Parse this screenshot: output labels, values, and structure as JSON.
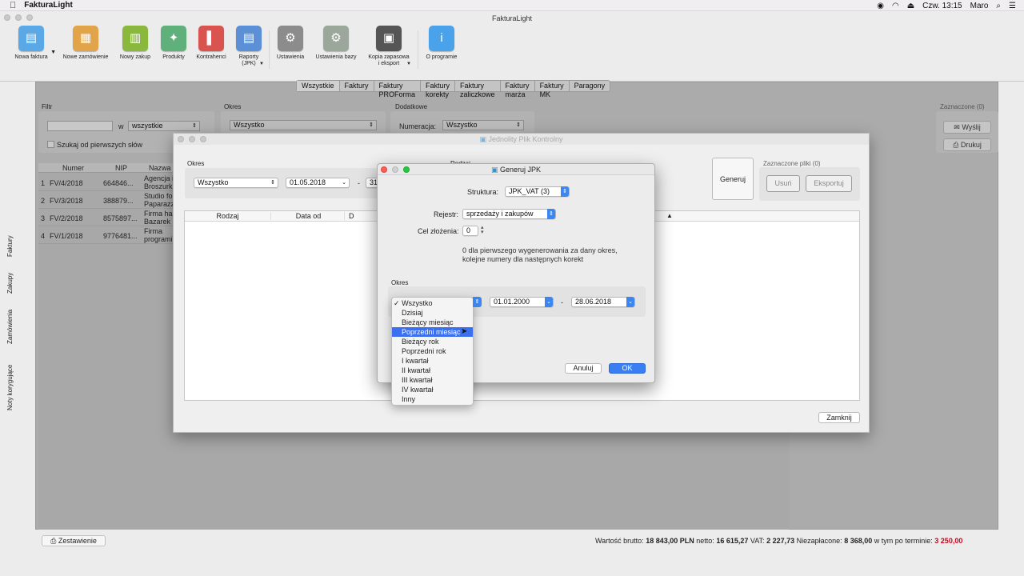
{
  "menubar": {
    "app": "FakturaLight",
    "clock": "Czw. 13:15",
    "user": "Maro"
  },
  "window": {
    "title": "FakturaLight"
  },
  "toolbar": {
    "items": [
      {
        "label": "Nowa faktura",
        "icon": "new-invoice-icon",
        "color": "#5aa8e6"
      },
      {
        "label": "Nowe zamówienie",
        "icon": "new-order-icon",
        "color": "#e2a44a"
      },
      {
        "label": "Nowy zakup",
        "icon": "basket-icon",
        "color": "#8ab83d"
      },
      {
        "label": "Produkty",
        "icon": "products-icon",
        "color": "#5fb07a"
      },
      {
        "label": "Kontrahenci",
        "icon": "contacts-icon",
        "color": "#d9534f"
      },
      {
        "label": "Raporty",
        "label2": "(JPK)",
        "icon": "reports-icon",
        "color": "#5b8fd6"
      },
      {
        "label": "Ustawienia",
        "icon": "settings-icon",
        "color": "#8c8c8c"
      },
      {
        "label": "Ustawienia bazy",
        "icon": "database-settings-icon",
        "color": "#9aa79a"
      },
      {
        "label": "Kopia zapasowa",
        "label2": "i eksport",
        "icon": "backup-icon",
        "color": "#555555"
      },
      {
        "label": "O programie",
        "icon": "info-icon",
        "color": "#4aa3ea"
      }
    ]
  },
  "tabs": [
    "Wszystkie",
    "Faktury",
    "Faktury PROForma",
    "Faktury korekty",
    "Faktury zaliczkowe",
    "Faktury marża",
    "Faktury MK",
    "Paragony"
  ],
  "filter": {
    "filtr_label": "Filtr",
    "w_label": "w",
    "w_value": "wszystkie",
    "search_words": "Szukaj od pierwszych słów",
    "okres_label": "Okres",
    "okres_value": "Wszystko",
    "dodatkowe_label": "Dodatkowe",
    "numeracja_label": "Numeracja:",
    "numeracja_value": "Wszystko",
    "zaznaczone_label": "Zaznaczone (0)",
    "wyslij": "Wyślij",
    "drukuj": "Drukuj"
  },
  "invoice_table": {
    "headers": [
      "Numer",
      "NIP",
      "Nazwa"
    ],
    "rows": [
      {
        "n": "1",
        "numer": "FV/4/2018",
        "nip": "664846...",
        "nazwa": "Agencja i",
        "nazwa2": "Broszurk"
      },
      {
        "n": "2",
        "numer": "FV/3/2018",
        "nip": "388879...",
        "nazwa": "Studio fo",
        "nazwa2": "Paparazz"
      },
      {
        "n": "3",
        "numer": "FV/2/2018",
        "nip": "8575897...",
        "nazwa": "Firma ha",
        "nazwa2": "Bazarek"
      },
      {
        "n": "4",
        "numer": "FV/1/2018",
        "nip": "9776481...",
        "nazwa": "Firma",
        "nazwa2": "programi"
      }
    ]
  },
  "side_tabs": [
    "Faktury",
    "Zakupy",
    "Zamówienia",
    "Noty korygujące"
  ],
  "jpk_window": {
    "title": "Jednolity Plik Kontrolny",
    "okres_label": "Okres",
    "okres_value": "Wszystko",
    "date_from": "01.05.2018",
    "dash": "-",
    "date_to": "31.",
    "rodzaj_label": "Rodzaj",
    "generuj": "Generuj",
    "zaznaczone_pliki": "Zaznaczone pliki (0)",
    "usun": "Usuń",
    "eksportuj": "Eksportuj",
    "table_headers": [
      "Rodzaj",
      "Data od",
      "D"
    ],
    "zamknij": "Zamknij"
  },
  "dialog": {
    "title": "Generuj JPK",
    "struktura_label": "Struktura:",
    "struktura_value": "JPK_VAT (3)",
    "rejestr_label": "Rejestr:",
    "rejestr_value": "sprzedaży i zakupów",
    "cel_label": "Cel złożenia:",
    "cel_value": "0",
    "hint": "0 dla pierwszego wygenerowania za dany okres,",
    "hint2": "kolejne numery dla następnych korekt",
    "okres_label": "Okres",
    "date_from": "01.01.2000",
    "dash": "-",
    "date_to": "28.06.2018",
    "anuluj": "Anuluj",
    "ok": "OK"
  },
  "period_menu": {
    "selected": "Wszystko",
    "highlighted": "Poprzedni miesiąc",
    "items": [
      "Dzisiaj",
      "Bieżący miesiąc",
      "Poprzedni miesiąc",
      "Bieżący rok",
      "Poprzedni rok",
      "I kwartał",
      "II kwartał",
      "III kwartał",
      "IV kwartał",
      "Inny"
    ]
  },
  "footer": {
    "zestawienie": "Zestawienie",
    "brutto_label": "Wartość brutto:",
    "brutto": "18 843,00 PLN",
    "netto_label": "netto:",
    "netto": "16 615,27",
    "vat_label": "VAT:",
    "vat": "2 227,73",
    "niezaplacone_label": "Niezapłacone:",
    "niezaplacone": "8 368,00",
    "po_terminie_label": "w tym po terminie:",
    "po_terminie": "3 250,00",
    "overdue_color": "#d0021b"
  }
}
